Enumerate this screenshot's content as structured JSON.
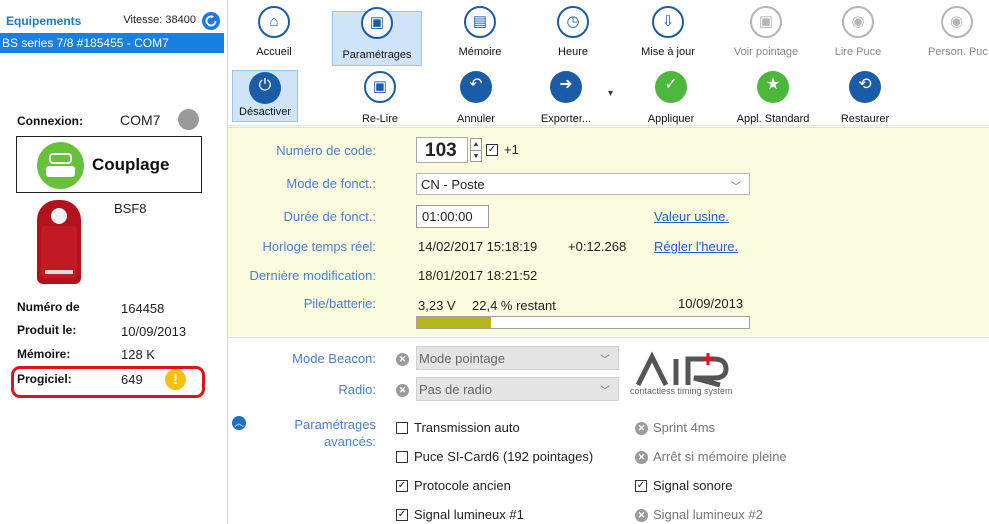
{
  "sidebar": {
    "title": "Equipements",
    "speed": "Vitesse: 38400",
    "device": "BS series 7/8 #185455 - COM7",
    "connexion_label": "Connexion:",
    "connexion_value": "COM7",
    "couplage_label": "Couplage",
    "model": "BSF8",
    "info": [
      {
        "label": "Numéro de",
        "value": "164458"
      },
      {
        "label": "Produit le:",
        "value": "10/09/2013"
      },
      {
        "label": "Mémoire:",
        "value": "128 K"
      },
      {
        "label": "Progiciel:",
        "value": "649"
      }
    ],
    "warning_glyph": "!"
  },
  "toolbar": {
    "row1": [
      {
        "label": "Accueil",
        "icon": "home-icon",
        "glyph": "⌂"
      },
      {
        "label": "Paramétrages",
        "icon": "settings-device-icon",
        "glyph": "▣"
      },
      {
        "label": "Mémoire",
        "icon": "memory-icon",
        "glyph": "▤"
      },
      {
        "label": "Heure",
        "icon": "clock-icon",
        "glyph": "◷"
      },
      {
        "label": "Mise à jour",
        "icon": "update-icon",
        "glyph": "⇩"
      },
      {
        "label": "Voir pointage",
        "icon": "view-punch-icon",
        "glyph": "▣"
      },
      {
        "label": "Lire Puce",
        "icon": "read-chip-icon",
        "glyph": "◉"
      },
      {
        "label": "Person. Puc",
        "icon": "personalize-chip-icon",
        "glyph": "◉"
      }
    ],
    "row2": [
      {
        "label": "Désactiver",
        "icon": "deactivate-icon",
        "glyph": "⏻"
      },
      {
        "label": "Re-Lire",
        "icon": "reread-icon",
        "glyph": "▣"
      },
      {
        "label": "Annuler",
        "icon": "undo-icon",
        "glyph": "↶"
      },
      {
        "label": "Exporter...",
        "icon": "export-icon",
        "glyph": "➜"
      },
      {
        "label": "Appliquer",
        "icon": "apply-check-icon",
        "glyph": "✓"
      },
      {
        "label": "Appl. Standard",
        "icon": "apply-standard-icon",
        "glyph": "★"
      },
      {
        "label": "Restaurer",
        "icon": "restore-icon",
        "glyph": "⟲"
      }
    ],
    "dropdown_marker": "▾"
  },
  "params": {
    "code_label": "Numéro de code:",
    "code_value": "103",
    "plus_one": "+1",
    "mode_label": "Mode de fonct.:",
    "mode_value": "CN - Poste",
    "duree_label": "Durée de fonct.:",
    "duree_value": "01:00:00",
    "valeur_usine": "Valeur usine.",
    "horloge_label": "Horloge temps réel:",
    "horloge_value": "14/02/2017 15:18:19",
    "horloge_offset": "+0:12.268",
    "regler": "Régler l'heure.",
    "derniere_label": "Dernière modification:",
    "derniere_value": "18/01/2017 18:21:52",
    "pile_label": "Pile/batterie:",
    "pile_voltage": "3,23 V",
    "pile_percent_text": "22,4 % restant",
    "pile_date": "10/09/2013",
    "pile_percent": 0.224
  },
  "beacon": {
    "mode_label": "Mode Beacon:",
    "mode_value": "Mode pointage",
    "radio_label": "Radio:",
    "radio_value": "Pas de radio",
    "logo_text": "AIR+",
    "logo_sub": "contactless timing system"
  },
  "advanced": {
    "label_line1": "Paramétrages",
    "label_line2": "avancés:",
    "options_left": [
      {
        "label": "Transmission auto",
        "checked": false
      },
      {
        "label": "Puce SI-Card6 (192 pointages)",
        "checked": false
      },
      {
        "label": "Protocole ancien",
        "checked": true
      },
      {
        "label": "Signal lumineux #1",
        "checked": true
      }
    ],
    "options_right": [
      {
        "label": "Sprint 4ms",
        "state": "disabled"
      },
      {
        "label": "Arrêt si mémoire pleine",
        "state": "disabled"
      },
      {
        "label": "Signal sonore",
        "state": "checked"
      },
      {
        "label": "Signal lumineux #2",
        "state": "disabled"
      }
    ]
  },
  "colors": {
    "accent": "#1b7fe0",
    "panel_bg": "#fbfbdf",
    "warning": "#f3c20c",
    "highlight": "#e0131b",
    "apply_green": "#4cb73a"
  }
}
